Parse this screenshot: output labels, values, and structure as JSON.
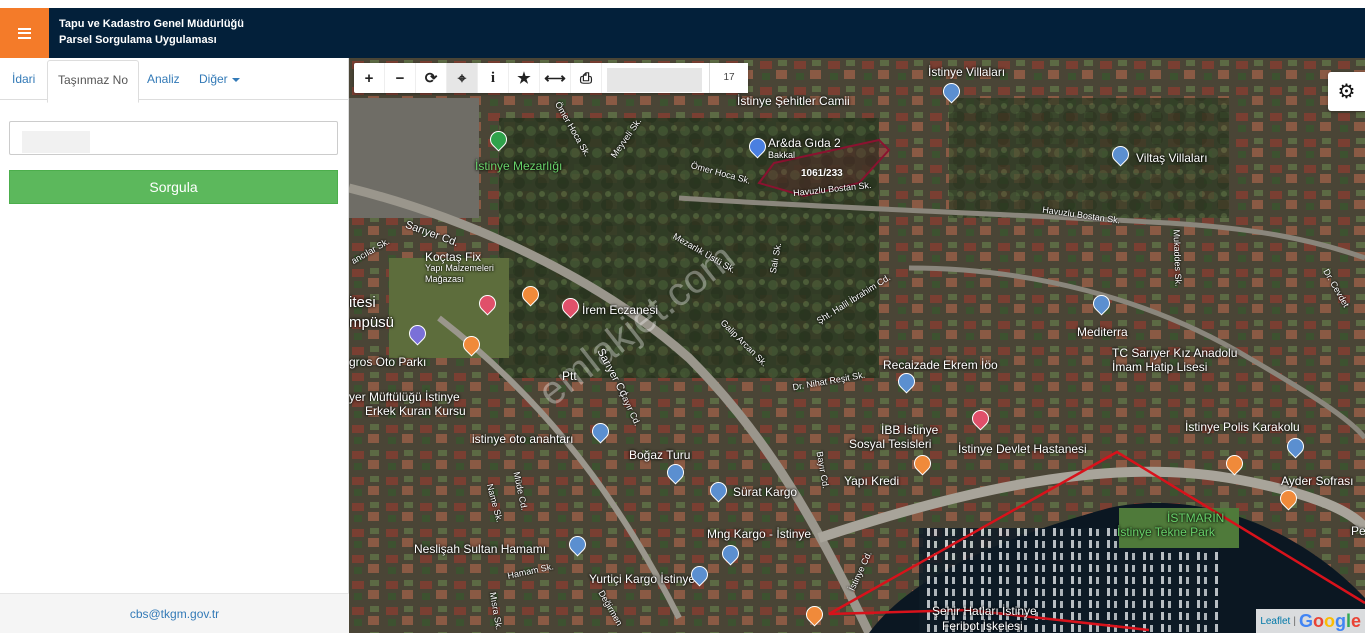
{
  "header": {
    "title_line1": "Tapu ve Kadastro Genel Müdürlüğü",
    "title_line2": "Parsel Sorgulama Uygulaması"
  },
  "sidebar": {
    "tabs": [
      {
        "label": "İdari",
        "active": false
      },
      {
        "label": "Taşınmaz No",
        "active": true
      },
      {
        "label": "Analiz",
        "active": false
      },
      {
        "label": "Diğer",
        "active": false
      }
    ],
    "search_value": "",
    "submit_label": "Sorgula",
    "footer_email": "cbs@tkgm.gov.tr"
  },
  "map": {
    "zoom": "17",
    "toolbar_icons": [
      "zoom-in-icon",
      "zoom-out-icon",
      "refresh-icon",
      "locate-icon",
      "info-icon",
      "star-icon",
      "measure-icon",
      "print-icon"
    ],
    "parcel_label": "1061/233",
    "watermark": "emlakjet.com",
    "attribution_leaflet": "Leaflet",
    "attribution_google": "Google",
    "places": {
      "istinye_villalari": "İstinye Villaları",
      "sehitler_camii": "İstinye Şehitler Camii",
      "arda_gida": "Ar&da Gıda 2",
      "bakkal": "Bakkal",
      "mezarligi": "İstinye Mezarlığı",
      "viltas": "Viltaş Villaları",
      "koctas": "Koçtaş Fix",
      "koctas_sub1": "Yapı Malzemeleri",
      "koctas_sub2": "Mağazası",
      "irem": "İrem Eczanesi",
      "itesi": "itesi",
      "mpusu": "mpüsü",
      "gros": "gros Oto Parkı",
      "ptt": "Ptt",
      "mediterra": "Mediterra",
      "tc_sariyer": "TC Sarıyer Kız Anadolu",
      "imam_hatip": "İmam Hatip Lisesi",
      "recaizade": "Recaizade Ekrem İöo",
      "muftu": "yer Müftülüğü İstinye",
      "kuran": "Erkek Kuran Kursu",
      "ibb1": "İBB İstinye",
      "ibb2": "Sosyal Tesisleri",
      "devlet": "İstinye Devlet Hastanesi",
      "polis": "İstinye Polis Karakolu",
      "oto_anahtari": "istinye oto anahtarı",
      "bogaz": "Boğaz Turu",
      "surat": "Sürat Kargo",
      "yapi_kredi": "Yapı Kredi",
      "ayder": "Ayder Sofrası",
      "istmarin": "İSTMARİN",
      "tekne_park": "İstinye Tekne Park",
      "neslisah": "Neslişah Sultan Hamamı",
      "mng": "Mng Kargo - İstinye",
      "yurtici": "Yurtiçi Kargo İstinye",
      "sehir_hatlari": "Şehir Hatları İstinye",
      "feribot": "Feribot İskelesi",
      "pe": "Pe"
    },
    "streets": {
      "omer_hoca1": "Ömer Hoca Sk.",
      "omer_hoca2": "Ömer Hoca Sk.",
      "meyveli": "Meyveli Sk.",
      "havuzlu1": "Havuzlu Bostan Sk.",
      "havuzlu2": "Havuzlu Bostan Sk.",
      "sariyer_cd1": "Sarıyer Cd.",
      "sariyer_cd2": "Sarıyer Cd.",
      "mezarlik": "Mezarlık Üstü Sk.",
      "sali": "Salı Sk.",
      "halil": "Şht. Halil İbrahim Cd.",
      "galip": "Galip Arcan Sk.",
      "nihat": "Dr. Nihat Reşit Sk.",
      "mukaddes": "Mukaddes Sk.",
      "cevdet": "Dr. Cevdet",
      "cayir": "Çayır Cd.",
      "bayir": "Bayır Cd.",
      "name": "Name Sk.",
      "mude": "Müde Cd.",
      "hamam": "Hamam Sk.",
      "misra": "Mısra Sk.",
      "degirmen": "Değirmen",
      "istinye_cd": "İstinye Cd.",
      "ancilar": "ancılar Sk."
    }
  }
}
